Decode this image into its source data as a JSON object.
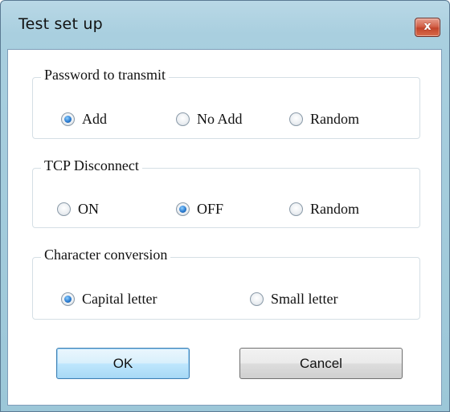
{
  "window": {
    "title": "Test set up",
    "close_glyph": "x"
  },
  "groups": [
    {
      "label": "Password to transmit",
      "options": [
        {
          "label": "Add",
          "checked": true
        },
        {
          "label": "No Add",
          "checked": false
        },
        {
          "label": "Random",
          "checked": false
        }
      ]
    },
    {
      "label": "TCP Disconnect",
      "options": [
        {
          "label": "ON",
          "checked": false
        },
        {
          "label": "OFF",
          "checked": true
        },
        {
          "label": "Random",
          "checked": false
        }
      ]
    },
    {
      "label": "Character conversion",
      "options": [
        {
          "label": "Capital letter",
          "checked": true
        },
        {
          "label": "Small letter",
          "checked": false
        }
      ]
    }
  ],
  "buttons": {
    "ok_label": "OK",
    "cancel_label": "Cancel"
  },
  "colors": {
    "titlebar": "#a9cfdf",
    "close_button": "#c2452c",
    "radio_selected": "#2b7bd0",
    "default_button_border": "#3c7fb1"
  }
}
